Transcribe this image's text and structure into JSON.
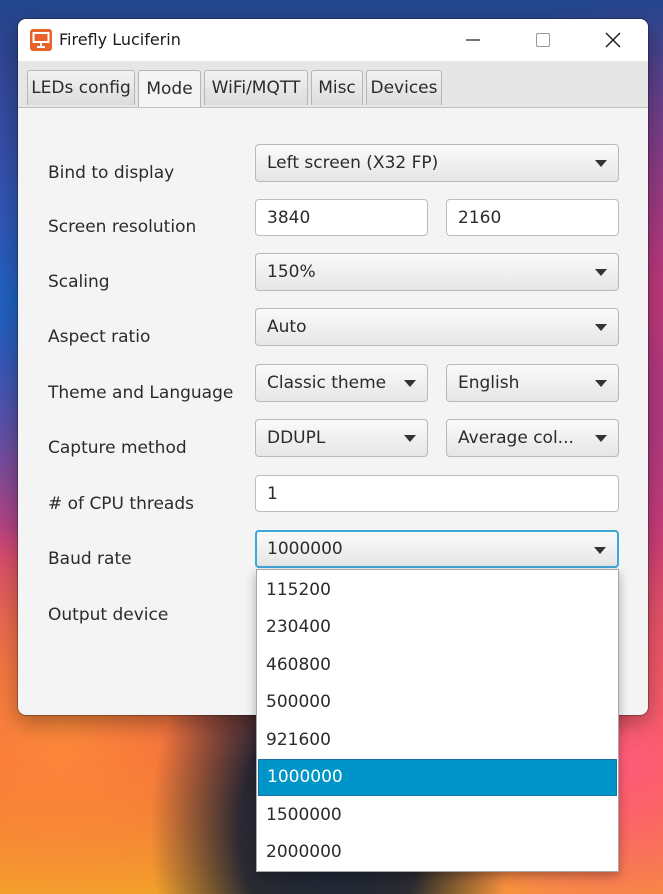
{
  "window": {
    "title": "Firefly Luciferin"
  },
  "tabs": [
    "LEDs config",
    "Mode",
    "WiFi/MQTT",
    "Misc",
    "Devices"
  ],
  "active_tab": "Mode",
  "form": {
    "bind_display": {
      "label": "Bind to display",
      "value": "Left screen (X32 FP)"
    },
    "resolution": {
      "label": "Screen resolution",
      "width": "3840",
      "height": "2160"
    },
    "scaling": {
      "label": "Scaling",
      "value": "150%"
    },
    "aspect": {
      "label": "Aspect ratio",
      "value": "Auto"
    },
    "theme_lang": {
      "label": "Theme and Language",
      "theme": "Classic theme",
      "language": "English"
    },
    "capture": {
      "label": "Capture method",
      "method": "DDUPL",
      "algorithm": "Average col..."
    },
    "cpu_threads": {
      "label": "# of CPU threads",
      "value": "1"
    },
    "baud_rate": {
      "label": "Baud rate",
      "value": "1000000"
    },
    "output_device": {
      "label": "Output device"
    }
  },
  "baud_options": [
    "115200",
    "230400",
    "460800",
    "500000",
    "921600",
    "1000000",
    "1500000",
    "2000000"
  ],
  "baud_selected": "1000000",
  "colors": {
    "accent": "#0095c8",
    "focus": "#3fa6d8",
    "app_icon": "#e8632a"
  },
  "icons": {
    "app": "monitor-logo-icon",
    "minimize": "minimize-icon",
    "maximize": "maximize-icon",
    "close": "close-icon",
    "dropdown": "chevron-down-icon"
  }
}
